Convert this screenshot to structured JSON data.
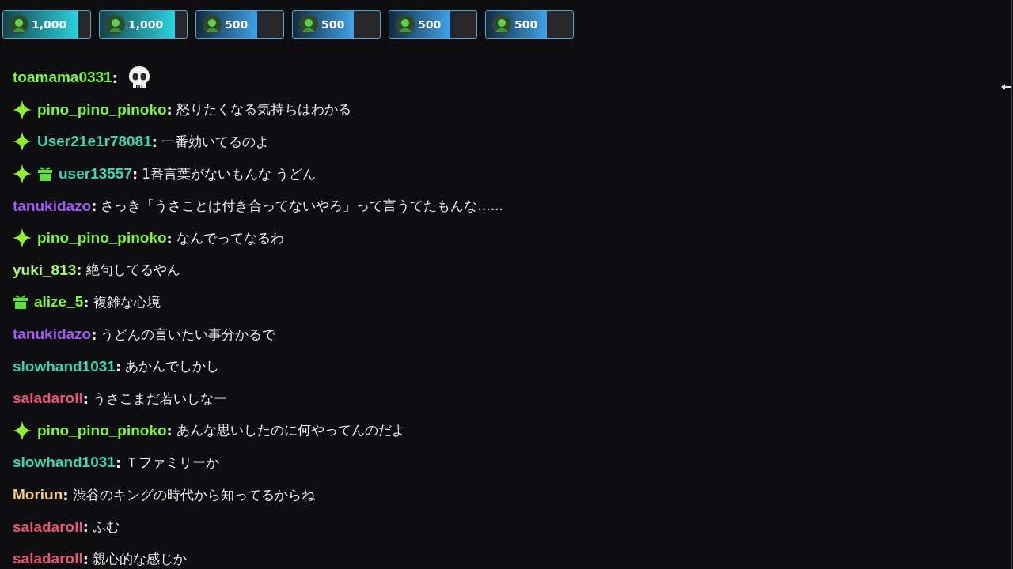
{
  "leaderboard": [
    {
      "amount": "1,000",
      "level": 0.86
    },
    {
      "amount": "1,000",
      "level": 0.86
    },
    {
      "amount": "500",
      "level": 0.7
    },
    {
      "amount": "500",
      "level": 0.7
    },
    {
      "amount": "500",
      "level": 0.7
    },
    {
      "amount": "500",
      "level": 0.7
    }
  ],
  "messages": [
    {
      "user": "toamama0331",
      "color": "#7cf53c",
      "sparkle_badge": false,
      "gift_badge": false,
      "separator": ":",
      "kind": "emote"
    },
    {
      "user": "pino_pino_pinoko",
      "color": "#7cf53c",
      "sparkle_badge": true,
      "gift_badge": false,
      "separator": ":",
      "kind": "text",
      "text": "怒りたくなる気持ちはわかる"
    },
    {
      "user": "User21e1r78081",
      "color": "#3fd4b0",
      "sparkle_badge": true,
      "gift_badge": false,
      "separator": ":",
      "kind": "text",
      "text": "一番効いてるのよ"
    },
    {
      "user": "user13557",
      "color": "#3fd4b0",
      "sparkle_badge": true,
      "gift_badge": true,
      "separator": ":",
      "kind": "text",
      "text": "1番言葉がないもんな うどん"
    },
    {
      "user": "tanukidazo",
      "color": "#a259f7",
      "sparkle_badge": false,
      "gift_badge": false,
      "separator": ":",
      "kind": "text",
      "text": "さっき「うさことは付き合ってないやろ」って言うてたもんな......"
    },
    {
      "user": "pino_pino_pinoko",
      "color": "#7cf53c",
      "sparkle_badge": true,
      "gift_badge": false,
      "separator": ":",
      "kind": "text",
      "text": "なんでってなるわ"
    },
    {
      "user": "yuki_813",
      "color": "#a8f57c",
      "sparkle_badge": false,
      "gift_badge": false,
      "separator": ":",
      "kind": "text",
      "text": "絶句してるやん"
    },
    {
      "user": "alize_5",
      "color": "#7cf53c",
      "sparkle_badge": false,
      "gift_badge": true,
      "separator": ":",
      "kind": "text",
      "text": "複雑な心境"
    },
    {
      "user": "tanukidazo",
      "color": "#a259f7",
      "sparkle_badge": false,
      "gift_badge": false,
      "separator": ":",
      "kind": "text",
      "text": "うどんの言いたい事分かるで"
    },
    {
      "user": "slowhand1031",
      "color": "#3fd4b0",
      "sparkle_badge": false,
      "gift_badge": false,
      "separator": ":",
      "kind": "text",
      "text": "あかんでしかし"
    },
    {
      "user": "saladaroll",
      "color": "#e8577a",
      "sparkle_badge": false,
      "gift_badge": false,
      "separator": ":",
      "kind": "text",
      "text": "うさこまだ若いしなー"
    },
    {
      "user": "pino_pino_pinoko",
      "color": "#7cf53c",
      "sparkle_badge": true,
      "gift_badge": false,
      "separator": ":",
      "kind": "text",
      "text": "あんな思いしたのに何やってんのだよ"
    },
    {
      "user": "slowhand1031",
      "color": "#3fd4b0",
      "sparkle_badge": false,
      "gift_badge": false,
      "separator": ":",
      "kind": "text",
      "text": "Ｔファミリーか"
    },
    {
      "user": "Moriun",
      "color": "#f5c98a",
      "sparkle_badge": false,
      "gift_badge": false,
      "separator": ":",
      "kind": "text",
      "text": "渋谷のキングの時代から知ってるからね"
    },
    {
      "user": "saladaroll",
      "color": "#e8577a",
      "sparkle_badge": false,
      "gift_badge": false,
      "separator": ":",
      "kind": "text",
      "text": "ふむ"
    },
    {
      "user": "saladaroll",
      "color": "#e8577a",
      "sparkle_badge": false,
      "gift_badge": false,
      "separator": ":",
      "kind": "text",
      "text": "親心的な感じか"
    }
  ]
}
